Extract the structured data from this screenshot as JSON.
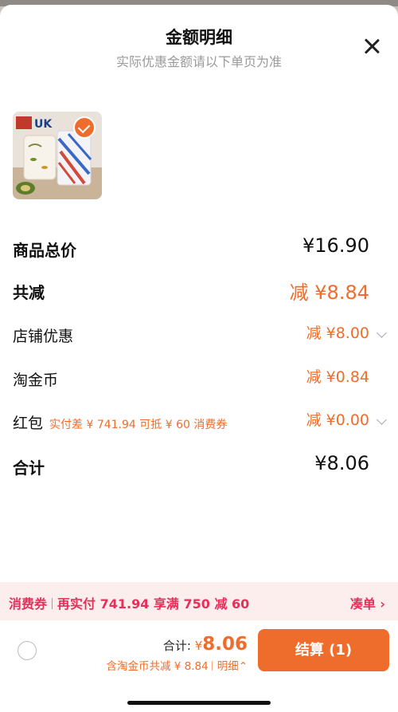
{
  "header": {
    "title": "金额明细",
    "subtitle": "实际优惠金额请以下单页为准"
  },
  "product": {
    "brand_text": "UK",
    "selected": true
  },
  "rows": {
    "goods_total": {
      "label": "商品总价",
      "value": "¥16.90"
    },
    "total_reduce": {
      "label": "共减",
      "value": "减 ¥8.84"
    },
    "shop_discount": {
      "label": "店铺优惠",
      "value": "减 ¥8.00"
    },
    "taojinbi": {
      "label": "淘金币",
      "value": "减 ¥0.84"
    },
    "red_packet": {
      "label": "红包",
      "hint": "实付差 ¥ 741.94 可抵 ¥ 60 消费券",
      "value": "减 ¥0.00"
    },
    "sum": {
      "label": "合计",
      "value": "¥8.06"
    }
  },
  "coupon_bar": {
    "tag": "消费券",
    "text": "再实付 741.94 享满 750 减 60",
    "action": "凑单"
  },
  "footer": {
    "total_label": "合计:",
    "currency": "¥",
    "amount": "8.06",
    "sub_text": "含淘金币共减 ¥ 8.84",
    "detail_link": "明细",
    "pay_button": "结算 (1)"
  },
  "colors": {
    "accent": "#ef6d2c",
    "coupon_text": "#e5305a",
    "coupon_bg": "#fdeeee"
  }
}
